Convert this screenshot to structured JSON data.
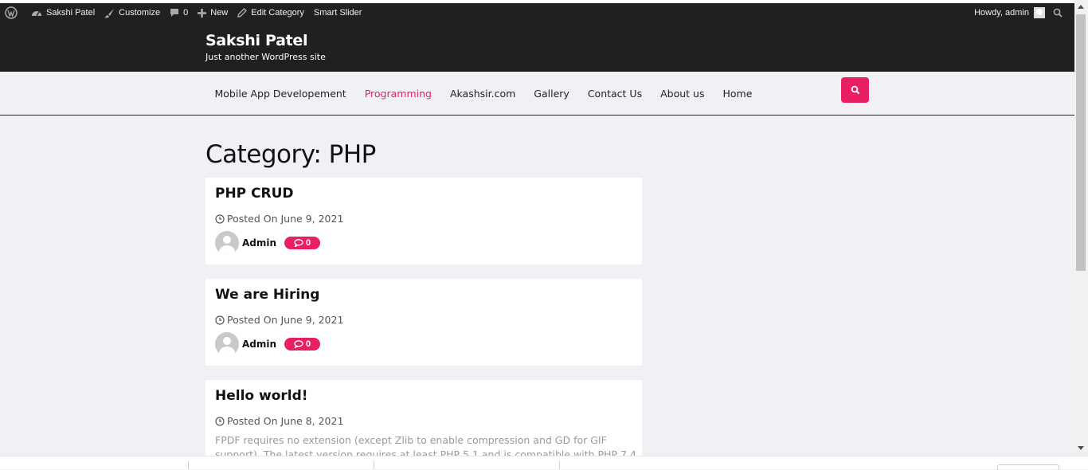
{
  "adminbar": {
    "site_name": "Sakshi Patel",
    "customize": "Customize",
    "comments_count": "0",
    "new_label": "New",
    "edit_category": "Edit Category",
    "smart_slider": "Smart Slider",
    "howdy": "Howdy, admin"
  },
  "header": {
    "title": "Sakshi Patel",
    "description": "Just another WordPress site"
  },
  "nav": {
    "items": [
      {
        "label": "Mobile App Developement"
      },
      {
        "label": "Programming"
      },
      {
        "label": "Akashsir.com"
      },
      {
        "label": "Gallery"
      },
      {
        "label": "Contact Us"
      },
      {
        "label": "About us"
      },
      {
        "label": "Home"
      }
    ],
    "active_index": 1
  },
  "main": {
    "page_title": "Category: PHP",
    "posts": [
      {
        "title": "PHP CRUD",
        "date": "Posted On June 9, 2021",
        "author": "Admin",
        "comments": "0"
      },
      {
        "title": "We are Hiring",
        "date": "Posted On June 9, 2021",
        "author": "Admin",
        "comments": "0"
      },
      {
        "title": "Hello world!",
        "date": "Posted On June 8, 2021",
        "excerpt": "FPDF requires no extension (except Zlib to enable compression and GD for GIF support). The latest version requires at least PHP 5.1 and is compatible with PHP 7.4"
      }
    ]
  },
  "colors": {
    "accent": "#e91e63",
    "header_bg": "#202020",
    "page_bg": "#f1f1f5"
  },
  "icons": {
    "wordpress": "wordpress-icon",
    "dashboard": "dashboard-icon",
    "customize": "brush-icon",
    "comments": "comment-icon",
    "new": "plus-icon",
    "edit": "pencil-icon",
    "search": "search-icon",
    "clock": "clock-icon"
  }
}
